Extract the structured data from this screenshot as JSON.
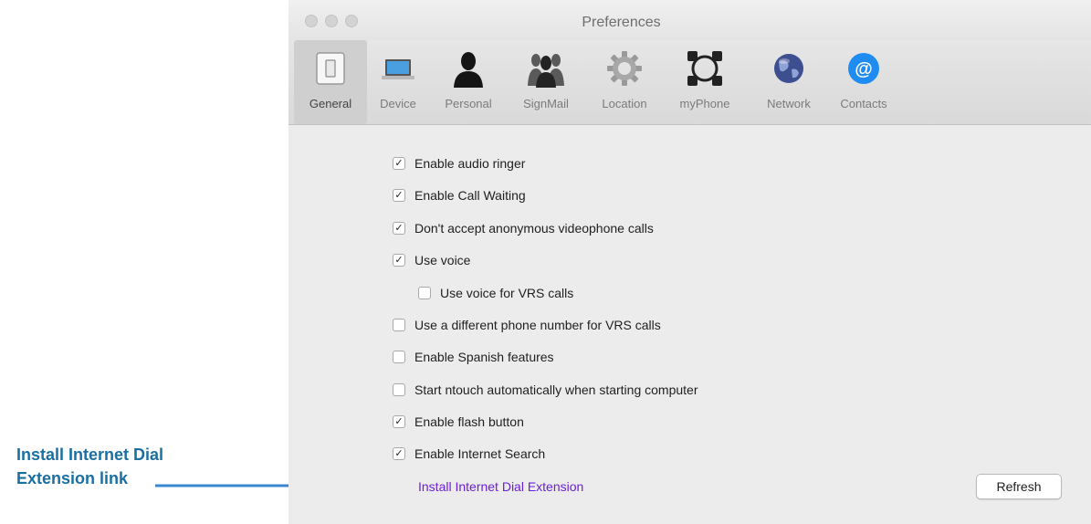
{
  "callout": {
    "line1": "Install Internet Dial",
    "line2": "Extension link"
  },
  "window": {
    "title": "Preferences"
  },
  "toolbar": {
    "tabs": [
      {
        "label": "General",
        "icon": "switch-icon",
        "active": true
      },
      {
        "label": "Device",
        "icon": "laptop-icon"
      },
      {
        "label": "Personal",
        "icon": "person-icon"
      },
      {
        "label": "SignMail",
        "icon": "group-icon"
      },
      {
        "label": "Location",
        "icon": "gear-icon"
      },
      {
        "label": "myPhone",
        "icon": "devices-ring-icon"
      },
      {
        "label": "Network",
        "icon": "globe-icon"
      },
      {
        "label": "Contacts",
        "icon": "at-sign-icon"
      }
    ]
  },
  "settings": {
    "items": [
      {
        "label": "Enable audio ringer",
        "checked": true
      },
      {
        "label": "Enable Call Waiting",
        "checked": true
      },
      {
        "label": "Don't accept anonymous videophone calls",
        "checked": true
      },
      {
        "label": "Use voice",
        "checked": true
      },
      {
        "label": "Use voice for VRS calls",
        "checked": false
      },
      {
        "label": "Use a different phone number for VRS calls",
        "checked": false
      },
      {
        "label": "Enable Spanish features",
        "checked": false
      },
      {
        "label": "Start ntouch automatically when starting computer",
        "checked": false
      },
      {
        "label": "Enable flash button",
        "checked": true
      },
      {
        "label": "Enable Internet Search",
        "checked": true
      }
    ],
    "install_link": "Install Internet Dial Extension",
    "refresh_label": "Refresh"
  },
  "colors": {
    "callout": "#1a6fa3",
    "link": "#6a1fd9",
    "contacts_icon": "#1e8cf0"
  }
}
